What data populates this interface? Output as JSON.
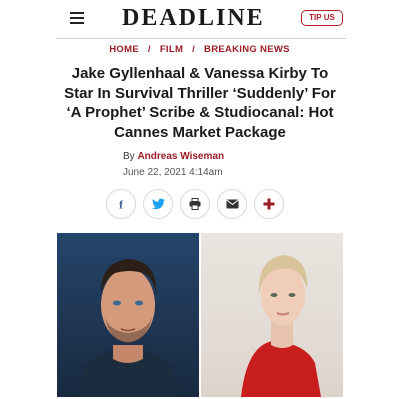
{
  "header": {
    "logo": "DEADLINE",
    "tip_label": "TIP US"
  },
  "breadcrumb": [
    "HOME",
    "FILM",
    "BREAKING NEWS"
  ],
  "breadcrumb_separator": "/",
  "article": {
    "title": "Jake Gyllenhaal & Vanessa Kirby To Star In Survival Thriller ‘Suddenly’ For ‘A Prophet’ Scribe & Studiocanal: Hot Cannes Market Package",
    "by_prefix": "By",
    "author": "Andreas Wiseman",
    "date": "June 22, 2021 4:14am"
  },
  "share_buttons": [
    "facebook-icon",
    "twitter-icon",
    "print-icon",
    "email-icon",
    "more-icon"
  ],
  "colors": {
    "brand_red": "#9b1c24",
    "facebook": "#3b5998",
    "twitter": "#1da1f2",
    "text": "#1a1a1a"
  }
}
